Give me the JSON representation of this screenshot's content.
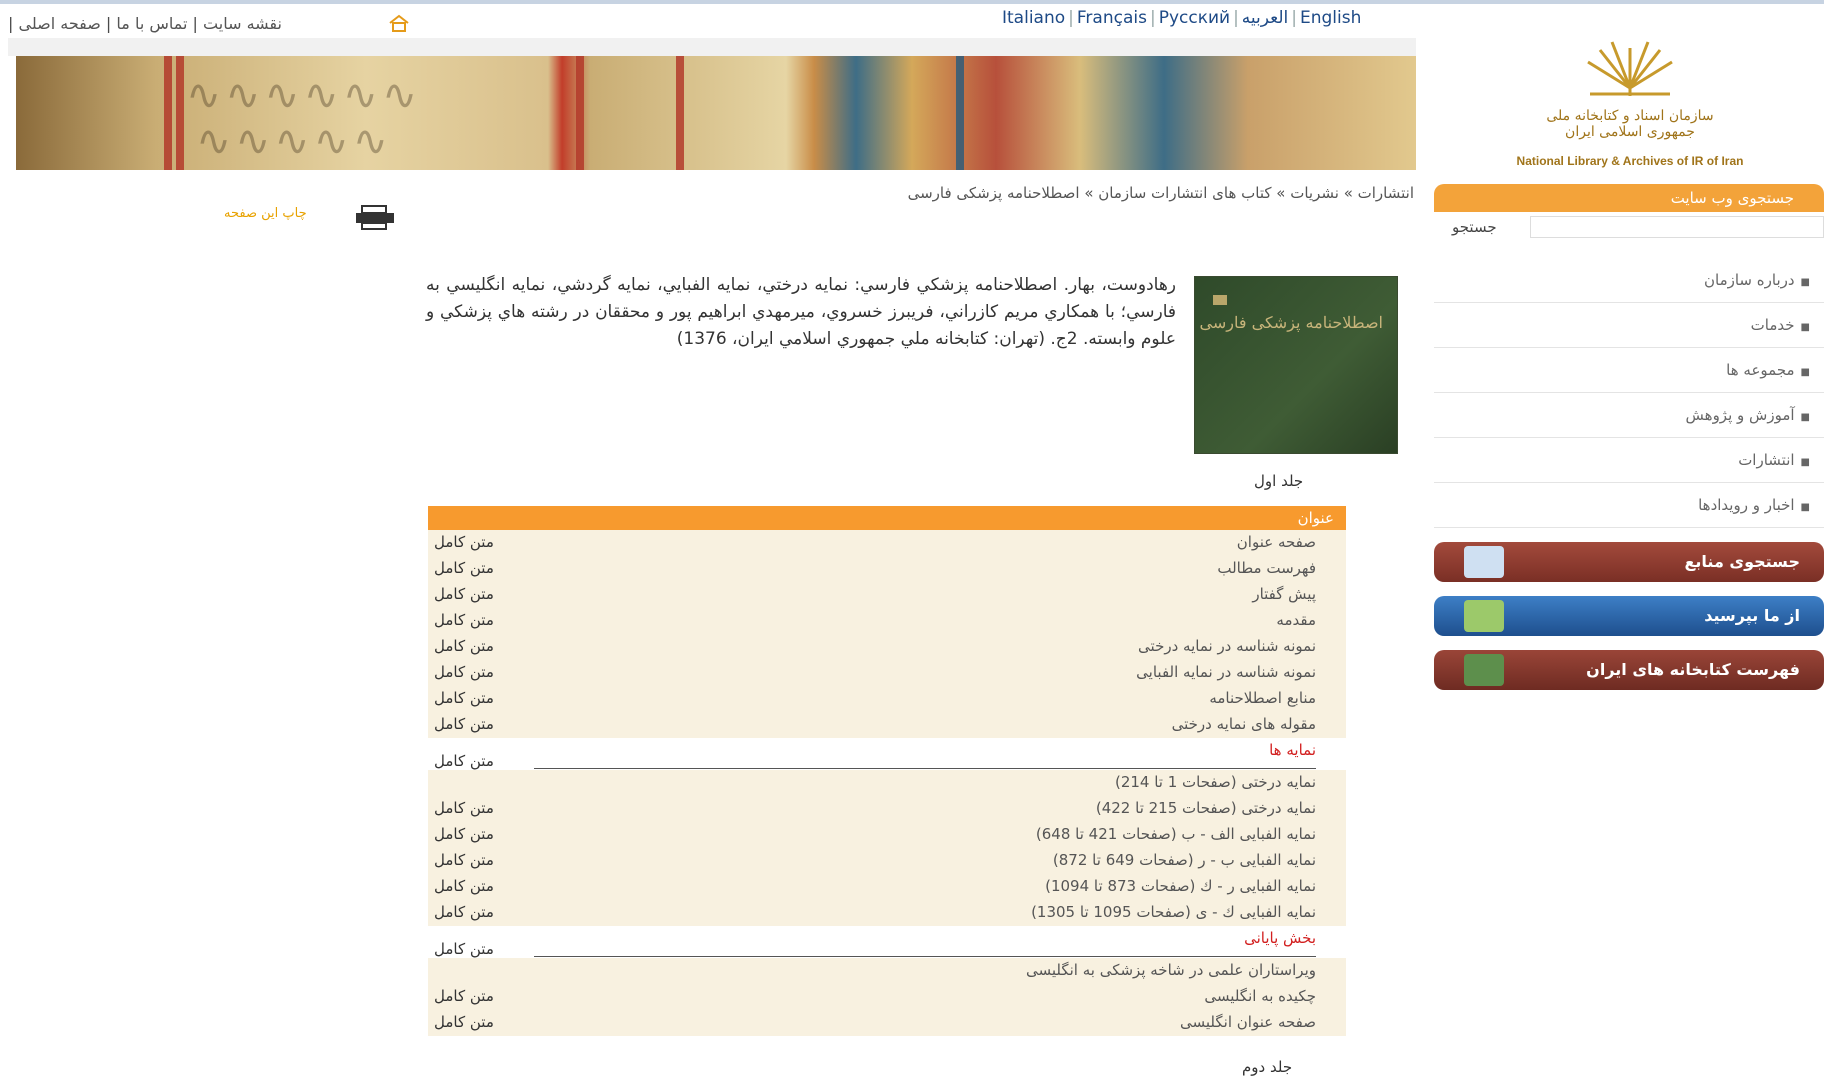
{
  "utility": {
    "items": [
      "صفحه اصلی",
      "تماس با ما",
      "نقشه سایت"
    ]
  },
  "languages": [
    "Italiano",
    "Français",
    "Русский",
    "العربیه",
    "English"
  ],
  "logo": {
    "fa_line1": "سازمان اسناد و کتابخانه ملی",
    "fa_line2": "جمهوری اسلامی ایران",
    "en": "National Library & Archives of IR of Iran"
  },
  "breadcrumb": "انتشارات » نشریات » کتاب های انتشارات سازمان » اصطلاحنامه پزشکی فارسی",
  "print": "چاپ این صفحه",
  "sidebar": {
    "search_title": "جستجوی وب سایت",
    "search_label": "جستجو",
    "items": [
      "درباره سازمان",
      "خدمات",
      "مجموعه ها",
      "آموزش و پژوهش",
      "انتشارات",
      "اخبار و رویدادها"
    ],
    "buttons": [
      "جستجوی منابع",
      "از ما بپرسید",
      "فهرست کتابخانه های ایران"
    ]
  },
  "book": {
    "cover_title": "اصطلاحنامه پزشکی فارسی",
    "citation": "رهادوست، بهار. اصطلاحنامه پزشکي فارسي: نمايه درختي، نمايه الفبايي، نمايه گردشي، نمايه انگليسي به فارسي؛ با همکاري مريم کازراني، فريبرز خسروي، ميرمهدي ابراهيم پور و محققان در رشته هاي پزشکي و علوم وابسته. 2ج. (تهران: کتابخانه ملي جمهوري اسلامي ايران، 1376)"
  },
  "volume1": "جلد اول",
  "volume2": "جلد دوم",
  "toc": {
    "header": "عنوان",
    "link_text": "متن کامل",
    "rows": [
      "صفحه عنوان",
      "فهرست مطالب",
      "پیش گفتار",
      "مقدمه",
      "نمونه شناسه در نمایه درختی",
      "نمونه شناسه در نمایه الفبایی",
      "منابع اصطلاحنامه",
      "مقوله های نمایه درختی"
    ],
    "section1": "نمایه ها",
    "indexes": [
      "نمایه درختی (صفحات 1 تا 214)",
      "نمایه درختی (صفحات 215 تا 422)",
      "نمایه الفبایی الف - ب (صفحات 421 تا 648)",
      "نمایه الفبایی ب - ر (صفحات 649 تا 872)",
      "نمایه الفبایی ر - ك (صفحات 873 تا 1094)",
      "نمایه الفبایی ك - ی (صفحات 1095 تا 1305)"
    ],
    "section2": "بخش پایانی",
    "final": [
      "ویراستاران علمی در شاخه پزشکی به انگلیسی",
      "چکیده به انگلیسی",
      "صفحه عنوان انگلیسی"
    ]
  },
  "colors": {
    "orange": "#f79a2e",
    "shade": "#f8f1e0",
    "section_red": "#d21f1f",
    "btn1": "#8b3a2f",
    "btn2": "#2a62a8",
    "btn3": "#7a2f25"
  }
}
